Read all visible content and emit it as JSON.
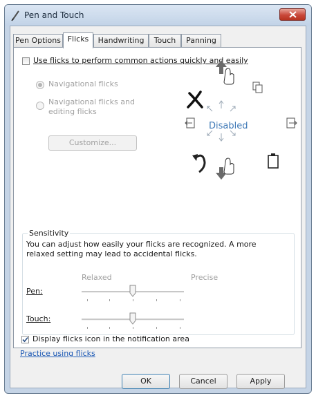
{
  "window": {
    "title": "Pen and Touch"
  },
  "tabs": [
    {
      "label": "Pen Options",
      "active": false
    },
    {
      "label": "Flicks",
      "active": true
    },
    {
      "label": "Handwriting",
      "active": false
    },
    {
      "label": "Touch",
      "active": false
    },
    {
      "label": "Panning",
      "active": false
    }
  ],
  "flicks": {
    "use_flicks_label": "Use flicks to perform common actions quickly and easily",
    "use_flicks_checked": false,
    "option_navigational": "Navigational flicks",
    "option_editing_line1": "Navigational flicks and",
    "option_editing_line2": "editing flicks",
    "customize_label": "Customize...",
    "status": "Disabled"
  },
  "sensitivity": {
    "title": "Sensitivity",
    "description_line1": "You can adjust how easily your flicks are recognized. A more",
    "description_line2": "relaxed setting may lead to accidental flicks.",
    "relaxed_label": "Relaxed",
    "precise_label": "Precise",
    "pen_label": "Pen:",
    "touch_label": "Touch:",
    "pen_level": 0.5,
    "touch_level": 0.5
  },
  "footer": {
    "display_icon_label": "Display flicks icon in the notification area",
    "display_icon_checked": true,
    "practice_link": "Practice using flicks"
  },
  "buttons": {
    "ok": "OK",
    "cancel": "Cancel",
    "apply": "Apply"
  },
  "colors": {
    "link": "#1a57b4",
    "status_text": "#3e78b6",
    "close_button": "#c9483a"
  }
}
